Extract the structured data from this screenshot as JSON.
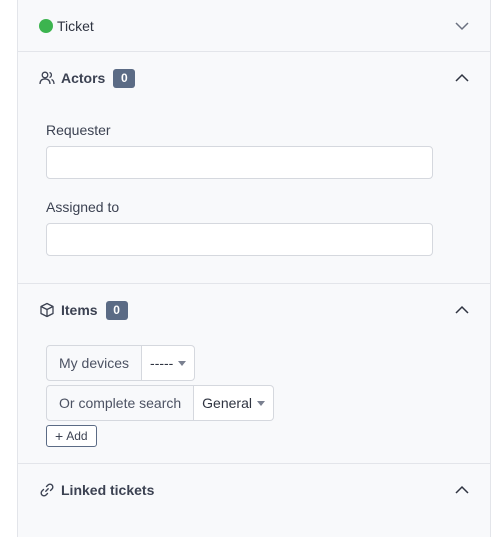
{
  "sections": {
    "ticket": {
      "title": "Ticket",
      "status_color": "#3cb44f",
      "icon": "status-dot",
      "collapse_icon": "chevron-down-icon"
    },
    "actors": {
      "title": "Actors",
      "badge": "0",
      "icon": "users-icon",
      "fields": {
        "requester": {
          "label": "Requester",
          "value": ""
        },
        "assigned": {
          "label": "Assigned to",
          "value": ""
        }
      }
    },
    "items": {
      "title": "Items",
      "badge": "0",
      "icon": "cube-icon",
      "my_devices": {
        "label": "My devices",
        "selected": "-----"
      },
      "complete_search": {
        "label": "Or complete search",
        "selected": "General"
      },
      "add_label": "Add"
    },
    "linked": {
      "title": "Linked tickets",
      "icon": "link-icon"
    }
  },
  "colors": {
    "badge": "#5b6b85",
    "border": "#e3e5ea",
    "panel_bg": "#f8f9fb"
  }
}
